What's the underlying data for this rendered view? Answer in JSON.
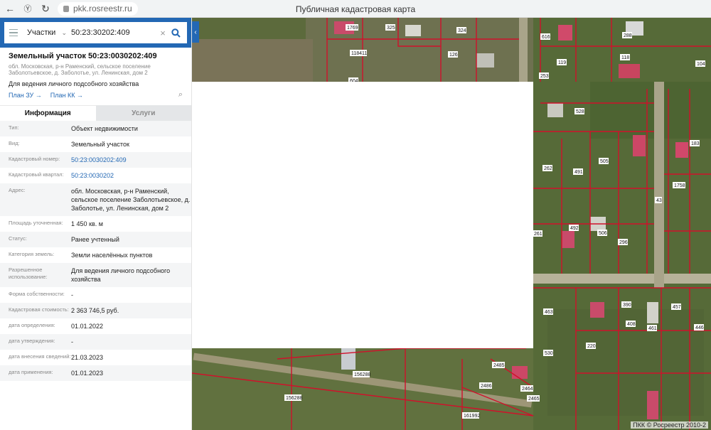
{
  "browser": {
    "url": "pkk.rosreestr.ru",
    "page_title": "Публичная кадастровая карта"
  },
  "search": {
    "type_label": "Участки",
    "query": "50:23:30202:409"
  },
  "object": {
    "title": "Земельный участок 50:23:0030202:409",
    "address_short": "обл. Московская, р-н Раменский, сельское поселение Заболотьевское, д. Заболотье, ул. Ленинская, дом 2",
    "purpose": "Для ведения личного подсобного хозяйства",
    "link_plan_zu": "План ЗУ →",
    "link_plan_kk": "План КК →"
  },
  "tabs": [
    {
      "label": "Информация",
      "active": true
    },
    {
      "label": "Услуги",
      "active": false
    }
  ],
  "info_rows": [
    {
      "label": "Тип:",
      "value": "Объект недвижимости"
    },
    {
      "label": "Вид:",
      "value": "Земельный участок"
    },
    {
      "label": "Кадастровый номер:",
      "value": "50:23:0030202:409"
    },
    {
      "label": "Кадастровый квартал:",
      "value": "50:23:0030202"
    },
    {
      "label": "Адрес:",
      "value": "обл. Московская, р-н Раменский, сельское поселение Заболотьевское, д. Заболотье, ул. Ленинская, дом 2"
    },
    {
      "label": "Площадь уточненная:",
      "value": "1 450 кв. м"
    },
    {
      "label": "Статус:",
      "value": "Ранее учтенный"
    },
    {
      "label": "Категория земель:",
      "value": "Земли населённых пунктов"
    },
    {
      "label": "Разрешенное использование:",
      "value": "Для ведения личного подсобного хозяйства"
    },
    {
      "label": "Форма собственности:",
      "value": "-"
    },
    {
      "label": "Кадастровая стоимость:",
      "value": "2 363 746,5 руб."
    },
    {
      "label": "дата определения:",
      "value": "01.01.2022"
    },
    {
      "label": "дата утверждения:",
      "value": "-"
    },
    {
      "label": "дата внесения сведений:",
      "value": "21.03.2023"
    },
    {
      "label": "дата применения:",
      "value": "01.01.2023"
    }
  ],
  "map": {
    "parcel_labels": [
      "1769",
      "325",
      "324",
      "616",
      "288",
      "118411",
      "126",
      "119",
      "118",
      "253",
      "104",
      "604",
      "528",
      "183",
      "505",
      "262",
      "491",
      "1758",
      "43",
      "261",
      "492",
      "506",
      "296",
      "463",
      "390",
      "457",
      "408",
      "461",
      "446",
      "530",
      "220",
      "2485",
      "2486",
      "2464",
      "2465",
      "156288",
      "161992",
      "262"
    ],
    "credit": "ПКК © Росреестр 2010-2"
  },
  "colors": {
    "accent": "#2368b4",
    "parcel_border": "#d0112b"
  }
}
